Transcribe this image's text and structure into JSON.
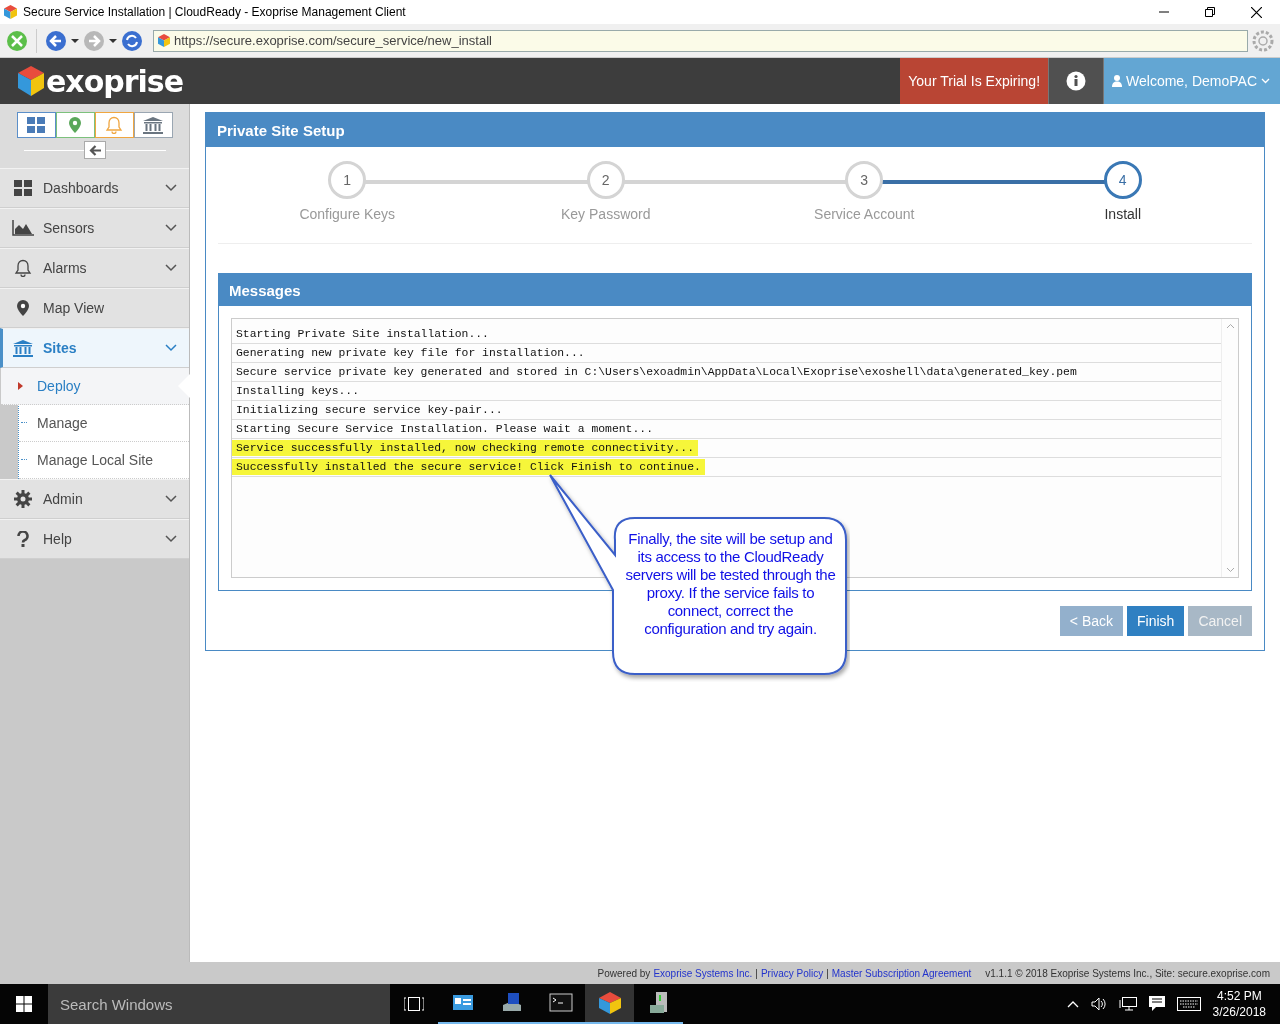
{
  "window": {
    "title": "Secure Service Installation | CloudReady - Exoprise Management Client"
  },
  "browser": {
    "url": "https://secure.exoprise.com/secure_service/new_install"
  },
  "header": {
    "logo": "exoprise",
    "trial_button": "Your Trial Is Expiring!",
    "user_menu": "Welcome, DemoPAC"
  },
  "sidebar": {
    "quick_buttons": [
      {
        "kind": "grid",
        "color": "#5b8fc9"
      },
      {
        "kind": "pin",
        "color": "#7cc17c"
      },
      {
        "kind": "bell",
        "color": "#f0a640"
      },
      {
        "kind": "bank",
        "color": "#9aa6b2"
      }
    ],
    "items": [
      {
        "label": "Dashboards",
        "kind": "grid",
        "has_menu": true,
        "expanded": false
      },
      {
        "label": "Sensors",
        "kind": "chart",
        "has_menu": true,
        "expanded": false
      },
      {
        "label": "Alarms",
        "kind": "bell",
        "has_menu": true,
        "expanded": false
      },
      {
        "label": "Map View",
        "kind": "pin",
        "has_menu": false,
        "expanded": false
      },
      {
        "label": "Sites",
        "kind": "bank",
        "has_menu": true,
        "expanded": true,
        "children": [
          {
            "label": "Deploy",
            "selected": true
          },
          {
            "label": "Manage",
            "selected": false
          },
          {
            "label": "Manage Local Site",
            "selected": false
          }
        ]
      },
      {
        "label": "Admin",
        "kind": "gear",
        "has_menu": true,
        "expanded": false
      },
      {
        "label": "Help",
        "kind": "question",
        "has_menu": true,
        "expanded": false
      }
    ]
  },
  "setup": {
    "title": "Private Site Setup",
    "steps": [
      {
        "number": "1",
        "label": "Configure Keys",
        "selected": false
      },
      {
        "number": "2",
        "label": "Key Password",
        "selected": false
      },
      {
        "number": "3",
        "label": "Service Account",
        "selected": false
      },
      {
        "number": "4",
        "label": "Install",
        "selected": true
      }
    ],
    "messages": {
      "title": "Messages",
      "lines": [
        {
          "text": "Starting Private Site installation...",
          "highlighted": false
        },
        {
          "text": "Generating new private key file for installation...",
          "highlighted": false
        },
        {
          "text": "Secure service private key generated and stored in C:\\Users\\exoadmin\\AppData\\Local\\Exoprise\\exoshell\\data\\generated_key.pem",
          "highlighted": false
        },
        {
          "text": "Installing keys...",
          "highlighted": false
        },
        {
          "text": "Initializing secure service key-pair...",
          "highlighted": false
        },
        {
          "text": "Starting Secure Service Installation. Please wait a moment...",
          "highlighted": false
        },
        {
          "text": "Service successfully installed, now checking remote connectivity...",
          "highlighted": true
        },
        {
          "text": "Successfully installed the secure service! Click Finish to continue.",
          "highlighted": true
        }
      ]
    },
    "buttons": [
      {
        "label": "< Back",
        "kind": "secondary",
        "disabled": true
      },
      {
        "label": "Finish",
        "kind": "primary",
        "disabled": false
      },
      {
        "label": "Cancel",
        "kind": "secondary",
        "disabled": false
      }
    ]
  },
  "callout": {
    "text": "Finally, the site will be setup and its access to the CloudReady servers will be tested through the proxy. If the service fails to connect, correct the configuration and try again."
  },
  "footer": {
    "parts": [
      {
        "kind": "text",
        "text": "Powered by"
      },
      {
        "kind": "link",
        "text": "Exoprise Systems Inc."
      },
      {
        "kind": "text",
        "text": "|"
      },
      {
        "kind": "link",
        "text": "Privacy Policy"
      },
      {
        "kind": "text",
        "text": "|"
      },
      {
        "kind": "link",
        "text": "Master Subscription Agreement"
      }
    ],
    "version": "v1.1.1 © 2018 Exoprise Systems Inc., Site: secure.exoprise.com"
  },
  "taskbar": {
    "search_placeholder": "Search Windows",
    "apps": [
      {
        "kind": "control-panel",
        "selected": false
      },
      {
        "kind": "server-tool",
        "selected": false
      },
      {
        "kind": "console",
        "selected": false
      },
      {
        "kind": "cube",
        "selected": true
      },
      {
        "kind": "server-box",
        "selected": false
      }
    ],
    "time": "4:52 PM",
    "date": "3/26/2018"
  }
}
